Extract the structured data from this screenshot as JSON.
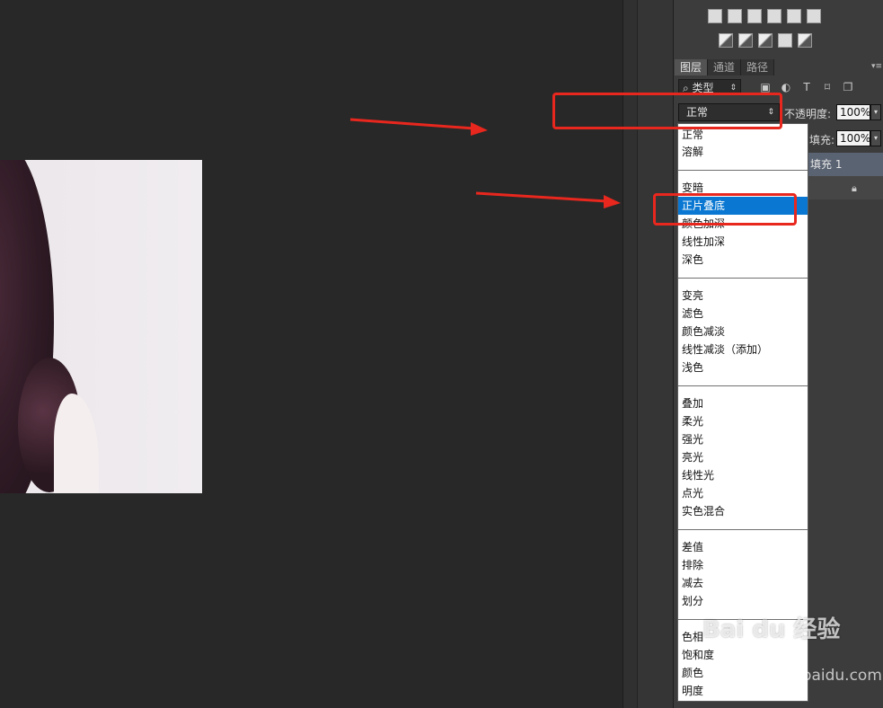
{
  "layers_panel": {
    "tabs": [
      {
        "label": "图层"
      },
      {
        "label": "通道"
      },
      {
        "label": "路径"
      }
    ],
    "filter_label": "类型",
    "blend_mode_selected": "正常",
    "opacity_label": "不透明度:",
    "opacity_value": "100%",
    "fill_label": "填充:",
    "fill_value": "100%",
    "layer_name": "填充 1"
  },
  "blend_modes": {
    "group1": [
      "正常",
      "溶解"
    ],
    "group2": [
      "变暗",
      "正片叠底",
      "颜色加深",
      "线性加深",
      "深色"
    ],
    "group3": [
      "变亮",
      "滤色",
      "颜色减淡",
      "线性减淡（添加）",
      "浅色"
    ],
    "group4": [
      "叠加",
      "柔光",
      "强光",
      "亮光",
      "线性光",
      "点光",
      "实色混合"
    ],
    "group5": [
      "差值",
      "排除",
      "减去",
      "划分"
    ],
    "group6": [
      "色相",
      "饱和度",
      "颜色",
      "明度"
    ],
    "highlighted": "正片叠底"
  },
  "watermark": {
    "text": "Bai du 经验",
    "url": "jingyan.baidu.com"
  },
  "colors": {
    "annotation_red": "#e8271e",
    "selection_blue": "#0a78d2",
    "canvas_bg": "#282828"
  }
}
